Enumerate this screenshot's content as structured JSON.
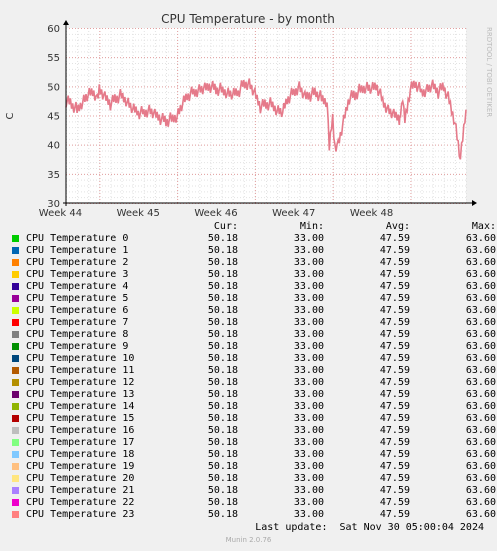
{
  "chart_data": {
    "type": "line",
    "title": "CPU Temperature - by month",
    "ylabel": "C",
    "ylim": [
      30,
      60
    ],
    "y_ticks": [
      "30",
      "35",
      "40",
      "45",
      "50",
      "55",
      "60"
    ],
    "x_ticks": [
      "Week 44",
      "Week 45",
      "Week 46",
      "Week 47",
      "Week 48"
    ],
    "grid": true,
    "x_day_range": [
      0,
      36
    ],
    "x_tick_days": [
      3,
      10,
      17,
      24,
      31
    ],
    "series": [
      {
        "name": "CPU Temperature 23",
        "color": "#e57a8a",
        "x": [
          0,
          0.5,
          1,
          1.5,
          2,
          2.5,
          2.8,
          3,
          3.5,
          4,
          4.5,
          5,
          5.5,
          6,
          6.5,
          7,
          7.5,
          8,
          8.5,
          9,
          9.5,
          10,
          10.5,
          11,
          11.5,
          12,
          12.5,
          13,
          13.5,
          14,
          14.5,
          15,
          15.5,
          16,
          16.5,
          17,
          17.5,
          18,
          18.5,
          19,
          19.5,
          20,
          20.5,
          21,
          21.5,
          22,
          22.5,
          23,
          23.5,
          23.7,
          24,
          24.2,
          24.5,
          25,
          25.5,
          26,
          26.5,
          27,
          27.5,
          28,
          28.5,
          29,
          29.5,
          30,
          30.1,
          30.3,
          30.5,
          31,
          31.5,
          32,
          32.5,
          33,
          33.5,
          34,
          34.5,
          35,
          35.5,
          36
        ],
        "y": [
          47.5,
          47,
          46,
          47.5,
          48.5,
          49,
          48,
          49.5,
          48,
          47,
          48,
          48.5,
          47.5,
          46,
          45.5,
          45.5,
          46,
          45,
          44.5,
          44,
          44.5,
          45,
          47,
          48.5,
          49,
          49.5,
          49.5,
          50,
          49.5,
          49.5,
          49,
          48.5,
          49,
          50.5,
          50.5,
          48.5,
          46.5,
          47,
          47,
          46,
          45.5,
          48,
          49,
          50,
          48,
          48.5,
          49,
          48,
          47.5,
          39,
          45,
          39.5,
          40,
          44,
          48,
          48.5,
          49.5,
          50,
          49.5,
          50,
          47.5,
          46,
          45,
          44.5,
          45.5,
          48,
          44,
          49.5,
          50.5,
          49,
          49.5,
          50,
          49,
          50,
          47.5,
          44,
          37.5,
          46
        ]
      }
    ],
    "legend_headers": {
      "cur": "Cur:",
      "min": "Min:",
      "avg": "Avg:",
      "max": "Max:"
    },
    "legend": [
      {
        "name": "CPU Temperature 0",
        "color": "#00cc00",
        "cur": "50.18",
        "min": "33.00",
        "avg": "47.59",
        "max": "63.60"
      },
      {
        "name": "CPU Temperature 1",
        "color": "#0066b3",
        "cur": "50.18",
        "min": "33.00",
        "avg": "47.59",
        "max": "63.60"
      },
      {
        "name": "CPU Temperature 2",
        "color": "#ff8000",
        "cur": "50.18",
        "min": "33.00",
        "avg": "47.59",
        "max": "63.60"
      },
      {
        "name": "CPU Temperature 3",
        "color": "#ffcc00",
        "cur": "50.18",
        "min": "33.00",
        "avg": "47.59",
        "max": "63.60"
      },
      {
        "name": "CPU Temperature 4",
        "color": "#330099",
        "cur": "50.18",
        "min": "33.00",
        "avg": "47.59",
        "max": "63.60"
      },
      {
        "name": "CPU Temperature 5",
        "color": "#990099",
        "cur": "50.18",
        "min": "33.00",
        "avg": "47.59",
        "max": "63.60"
      },
      {
        "name": "CPU Temperature 6",
        "color": "#ccff00",
        "cur": "50.18",
        "min": "33.00",
        "avg": "47.59",
        "max": "63.60"
      },
      {
        "name": "CPU Temperature 7",
        "color": "#ff0000",
        "cur": "50.18",
        "min": "33.00",
        "avg": "47.59",
        "max": "63.60"
      },
      {
        "name": "CPU Temperature 8",
        "color": "#808080",
        "cur": "50.18",
        "min": "33.00",
        "avg": "47.59",
        "max": "63.60"
      },
      {
        "name": "CPU Temperature 9",
        "color": "#008f00",
        "cur": "50.18",
        "min": "33.00",
        "avg": "47.59",
        "max": "63.60"
      },
      {
        "name": "CPU Temperature 10",
        "color": "#00487d",
        "cur": "50.18",
        "min": "33.00",
        "avg": "47.59",
        "max": "63.60"
      },
      {
        "name": "CPU Temperature 11",
        "color": "#b35a00",
        "cur": "50.18",
        "min": "33.00",
        "avg": "47.59",
        "max": "63.60"
      },
      {
        "name": "CPU Temperature 12",
        "color": "#b38f00",
        "cur": "50.18",
        "min": "33.00",
        "avg": "47.59",
        "max": "63.60"
      },
      {
        "name": "CPU Temperature 13",
        "color": "#6b006b",
        "cur": "50.18",
        "min": "33.00",
        "avg": "47.59",
        "max": "63.60"
      },
      {
        "name": "CPU Temperature 14",
        "color": "#8fb300",
        "cur": "50.18",
        "min": "33.00",
        "avg": "47.59",
        "max": "63.60"
      },
      {
        "name": "CPU Temperature 15",
        "color": "#b30000",
        "cur": "50.18",
        "min": "33.00",
        "avg": "47.59",
        "max": "63.60"
      },
      {
        "name": "CPU Temperature 16",
        "color": "#bebebe",
        "cur": "50.18",
        "min": "33.00",
        "avg": "47.59",
        "max": "63.60"
      },
      {
        "name": "CPU Temperature 17",
        "color": "#80ff80",
        "cur": "50.18",
        "min": "33.00",
        "avg": "47.59",
        "max": "63.60"
      },
      {
        "name": "CPU Temperature 18",
        "color": "#80c9ff",
        "cur": "50.18",
        "min": "33.00",
        "avg": "47.59",
        "max": "63.60"
      },
      {
        "name": "CPU Temperature 19",
        "color": "#ffc080",
        "cur": "50.18",
        "min": "33.00",
        "avg": "47.59",
        "max": "63.60"
      },
      {
        "name": "CPU Temperature 20",
        "color": "#ffe680",
        "cur": "50.18",
        "min": "33.00",
        "avg": "47.59",
        "max": "63.60"
      },
      {
        "name": "CPU Temperature 21",
        "color": "#aa80ff",
        "cur": "50.18",
        "min": "33.00",
        "avg": "47.59",
        "max": "63.60"
      },
      {
        "name": "CPU Temperature 22",
        "color": "#ee00cc",
        "cur": "50.18",
        "min": "33.00",
        "avg": "47.59",
        "max": "63.60"
      },
      {
        "name": "CPU Temperature 23",
        "color": "#ff8080",
        "cur": "50.18",
        "min": "33.00",
        "avg": "47.59",
        "max": "63.60"
      }
    ]
  },
  "side_label": "RRDTOOL / TOBI OETIKER",
  "last_update": "Last update:  Sat Nov 30 05:00:04 2024",
  "footer": "Munin 2.0.76"
}
